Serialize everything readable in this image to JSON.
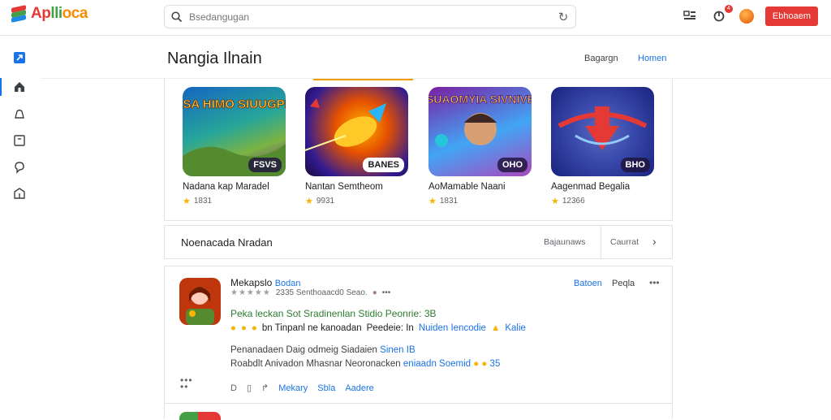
{
  "app": {
    "name_parts": [
      "Ap",
      "lli",
      "oca"
    ],
    "search_placeholder": "Bsedangugan",
    "top_button": "Ebhoaem",
    "notif_count": "4"
  },
  "header": {
    "title": "Nangia Ilnain",
    "link1": "Bagargn",
    "link2": "Homen"
  },
  "cards": [
    {
      "title": "Nadana kap Maradel",
      "rating": "1831",
      "badge": "FSVS"
    },
    {
      "title": "Nantan Semtheom",
      "rating": "9931",
      "badge": "BANES"
    },
    {
      "title": "AoMamable Naani",
      "rating": "1831",
      "badge": "OHO"
    },
    {
      "title": "Aagenmad Begalia",
      "rating": "12366",
      "badge": "BHO"
    }
  ],
  "card_art": {
    "c1": "AEABASA HIMO SIUUGPBBUAS",
    "c3": "SUAOMYIA SIVNIVE"
  },
  "section": {
    "title": "Noenacada Nradan",
    "sort": "Bajaunaws",
    "next": "Caurrat"
  },
  "review": {
    "name": "Mekapslo",
    "tag": "Bodan",
    "meta": "2335 Senthoaacd0 Seao.",
    "action1": "Batoen",
    "action2": "Peqla",
    "line1": "Peka leckan Sot Sradinenlan Stidio Peonrie: 3B",
    "line2_a": "bn Tinpanl ne kanoadan",
    "line2_b": "Peedeie: In",
    "line2_c": "Nuiden Iencodie",
    "line2_d": "Kalie",
    "line3_a": "Penanadaen Daig odmeig Siadaien",
    "line3_b": "Sinen IB",
    "line4_a": "Roabdlt Anivadon Mhasnar Neoronacken",
    "line4_b": "eniaadn Soemid",
    "line4_c": "35",
    "footer_count": "D",
    "footer_a": "Mekary",
    "footer_b": "Sbla",
    "footer_c": "Aadere"
  },
  "colors": {
    "accent": "#1a73e8",
    "brand_red": "#e53935",
    "tab_underline": "#f29b00",
    "positive_text": "#2e7d32"
  }
}
